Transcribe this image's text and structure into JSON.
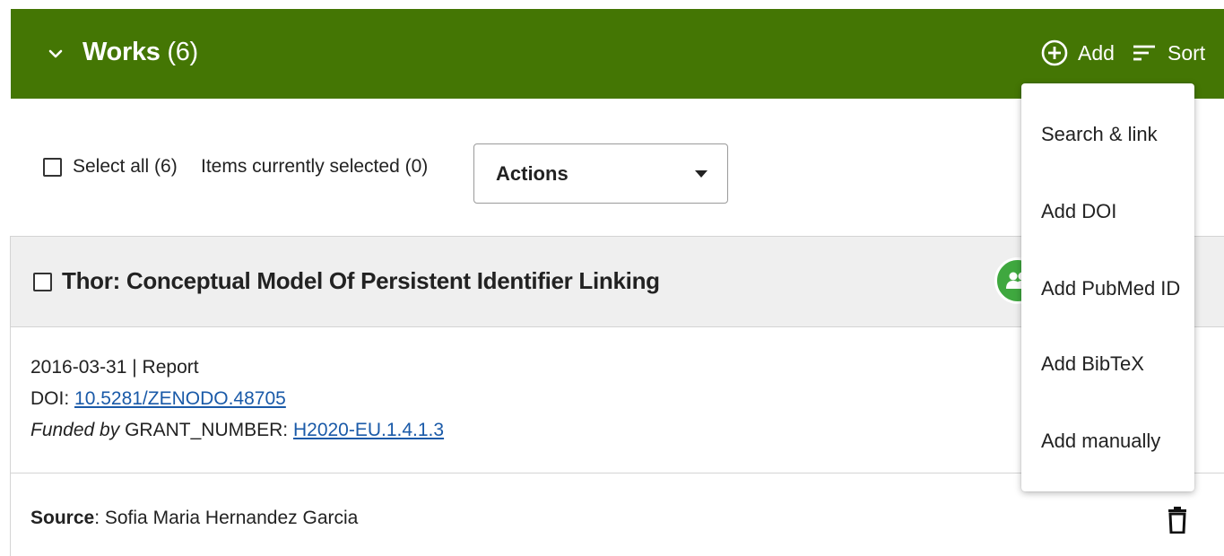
{
  "colors": {
    "header_bg": "#447604",
    "link": "#1a5aa8",
    "peer_badge": "#3fa83f"
  },
  "header": {
    "toggle_icon": "chevron-down-icon",
    "title": "Works",
    "count": "(6)",
    "add_label": "Add",
    "add_icon": "plus-circle-icon",
    "sort_label": "Sort",
    "sort_icon": "sort-lines-icon"
  },
  "toolbar": {
    "select_all_label": "Select all (6)",
    "selected_count_label": "Items currently selected (0)",
    "actions_label": "Actions"
  },
  "work": {
    "title": "Thor: Conceptual Model Of Persistent Identifier Linking",
    "date_type": "2016-03-31 | Report",
    "doi_prefix": "DOI:",
    "doi_value": "10.5281/ZENODO.48705",
    "funded_by_label": "Funded by",
    "grant_prefix": "GRANT_NUMBER:",
    "grant_value": "H2020-EU.1.4.1.3",
    "detail_link_fragment": "il",
    "source_label": "Source",
    "source_value": ": Sofia Maria Hernandez Garcia"
  },
  "add_menu": {
    "items": [
      {
        "label": "Search & link"
      },
      {
        "label": "Add DOI"
      },
      {
        "label": "Add PubMed ID"
      },
      {
        "label": "Add BibTeX"
      },
      {
        "label": "Add manually"
      }
    ]
  }
}
